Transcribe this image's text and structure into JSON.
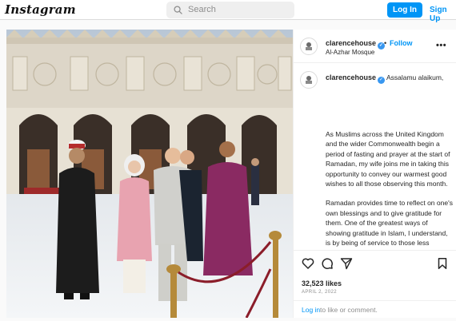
{
  "header": {
    "logo": "Instagram",
    "search_placeholder": "Search",
    "login_label": "Log In",
    "signup_label": "Sign Up"
  },
  "post": {
    "username": "clarencehouse",
    "separator": "•",
    "follow_label": "Follow",
    "location": "Al-Azhar Mosque",
    "more_label": "•••",
    "caption_first": "Assalamu alaikum,",
    "caption_paragraphs": [
      "As Muslims across the United Kingdom and the wider Commonwealth begin a period of fasting and prayer at the start of Ramadan, my wife joins me in taking this opportunity to convey our warmest good wishes to all those observing this month.",
      "Ramadan provides time to reflect on one's own blessings and to give gratitude for them. One of the greatest ways of showing gratitude in Islam, I understand, is by being of service to those less fortunate in our society. The generosity of spirit and kind-hearted hospitality of Muslims does not cease to astound me and I"
    ],
    "likes": "32,523 likes",
    "date": "APRIL 2, 2022",
    "login_link": "Log in",
    "login_rest": "to like or comment."
  },
  "icons": [
    "search-icon",
    "crest-icon",
    "verified-badge-icon",
    "heart-icon",
    "comment-icon",
    "share-icon",
    "bookmark-icon"
  ],
  "colors": {
    "accent": "#0095f6",
    "verified": "#3897f0",
    "text": "#262626",
    "muted": "#8e8e8e"
  }
}
